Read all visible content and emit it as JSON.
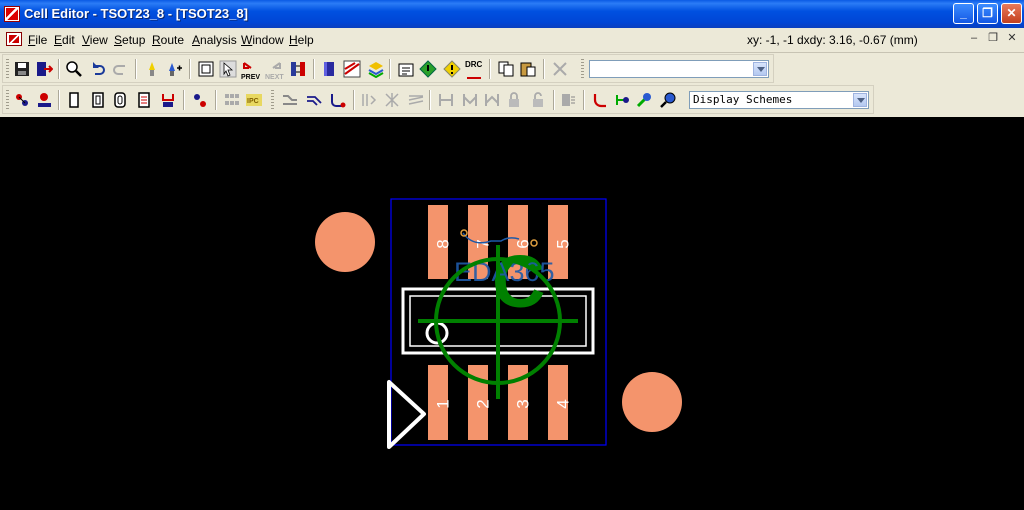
{
  "window": {
    "title": "Cell Editor - TSOT23_8 - [TSOT23_8]",
    "min_glyph": "_",
    "max_glyph": "❐",
    "close_glyph": "✕"
  },
  "menu": {
    "items": [
      {
        "key": "F",
        "rest": "ile"
      },
      {
        "key": "E",
        "rest": "dit"
      },
      {
        "key": "V",
        "rest": "iew"
      },
      {
        "key": "S",
        "rest": "etup"
      },
      {
        "key": "R",
        "rest": "oute"
      },
      {
        "key": "A",
        "rest": "nalysis"
      },
      {
        "key": "W",
        "rest": "indow"
      },
      {
        "key": "H",
        "rest": "elp"
      }
    ],
    "coords": "xy: -1, -1  dxdy: 3.16, -0.67 (mm)",
    "mdi_min": "–",
    "mdi_restore": "❐",
    "mdi_close": "✕"
  },
  "toolbar": {
    "combo1_value": "",
    "display_schemes": "Display Schemes",
    "prev_label": "PREV",
    "next_label": "NEXT",
    "drc_label": "DRC"
  },
  "pcb": {
    "pin_labels": [
      "8",
      "7",
      "6",
      "5",
      "1",
      "2",
      "3",
      "4"
    ],
    "watermark_text": "EDA365",
    "watermark_letter": "C",
    "colors": {
      "background": "#000000",
      "pad": "#f4946c",
      "silkscreen": "#ffffff",
      "outline": "#0000ff",
      "origin": "#008000",
      "watermark": "#1e5aa8"
    }
  }
}
